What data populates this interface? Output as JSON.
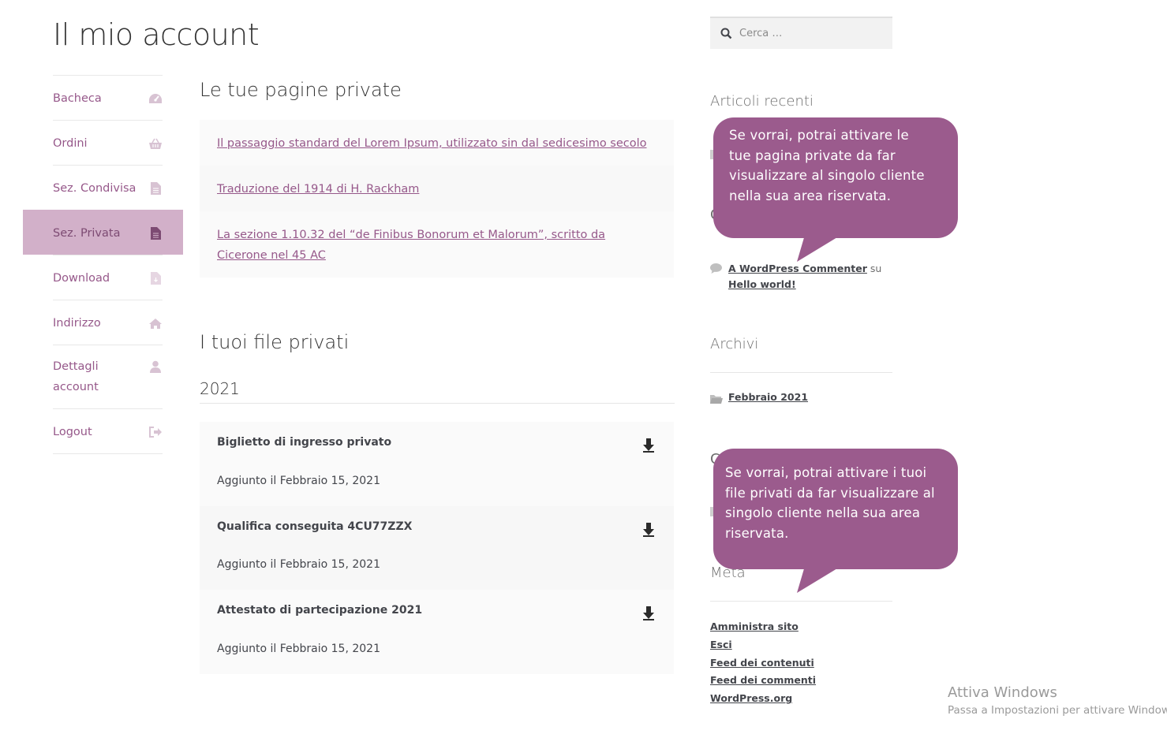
{
  "page": {
    "title": "Il mio account"
  },
  "nav": {
    "items": [
      {
        "label": "Bacheca",
        "icon": "dashboard-icon"
      },
      {
        "label": "Ordini",
        "icon": "basket-icon"
      },
      {
        "label": "Sez. Condivisa",
        "icon": "document-icon"
      },
      {
        "label": "Sez. Privata",
        "icon": "document-icon",
        "active": true
      },
      {
        "label": "Download",
        "icon": "file-download-icon"
      },
      {
        "label": "Indirizzo",
        "icon": "home-icon"
      },
      {
        "label": "Dettagli account",
        "icon": "user-icon"
      },
      {
        "label": "Logout",
        "icon": "sign-out-icon"
      }
    ]
  },
  "private_pages": {
    "heading": "Le tue pagine private",
    "links": [
      "Il passaggio standard del Lorem Ipsum, utilizzato sin dal sedicesimo secolo",
      "Traduzione del 1914 di H. Rackham",
      "La sezione 1.10.32 del “de Finibus Bonorum et Malorum”, scritto da Cicerone nel 45 AC"
    ]
  },
  "private_files": {
    "heading": "I tuoi file privati",
    "year": "2021",
    "files": [
      {
        "title": "Biglietto di ingresso privato",
        "date": "Aggiunto il Febbraio 15, 2021"
      },
      {
        "title": "Qualifica conseguita 4CU77ZZX",
        "date": "Aggiunto il Febbraio 15, 2021"
      },
      {
        "title": "Attestato di partecipazione 2021",
        "date": "Aggiunto il Febbraio 15, 2021"
      }
    ]
  },
  "sidebar": {
    "search_placeholder": "Cerca …",
    "recent_posts_title": "Articoli recenti",
    "recent_comments": {
      "author": "A WordPress Commenter",
      "connector": "su",
      "post": "Hello world!"
    },
    "archives_title": "Archivi",
    "archive_link": "Febbraio 2021",
    "meta_title": "Meta",
    "meta_links": [
      "Amministra sito",
      "Esci",
      "Feed dei contenuti",
      "Feed dei commenti",
      "WordPress.org"
    ]
  },
  "tooltips": {
    "pages": "Se vorrai, potrai attivare le tue pagina private da far visualizzare al singolo cliente nella sua area riservata.",
    "files": "Se vorrai, potrai attivare i tuoi file privati da far visualizzare al singolo cliente nella sua area riservata."
  },
  "watermark": {
    "title": "Attiva Windows",
    "subtitle": "Passa a Impostazioni per attivare Windows."
  },
  "colors": {
    "accent": "#96588a",
    "active_bg": "#d2b0c9",
    "bubble": "#9b5b8d"
  }
}
